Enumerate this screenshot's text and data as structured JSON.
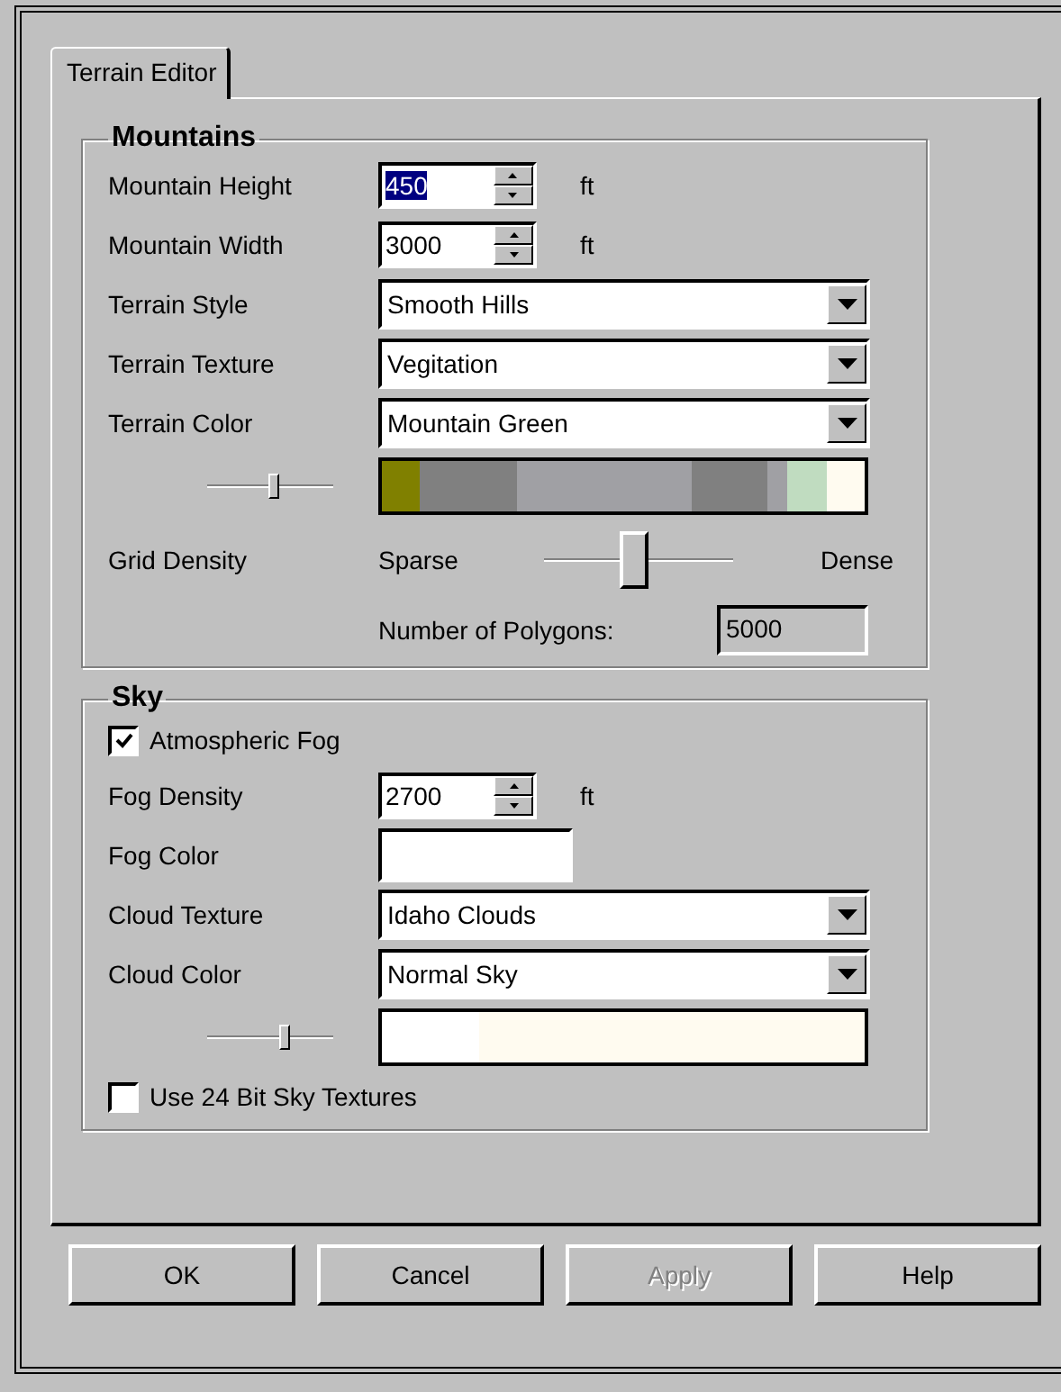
{
  "tab": {
    "label": "Terrain Editor",
    "selected": true
  },
  "groups": [
    {
      "title": "Mountains",
      "rows": [
        {
          "kind": "spinner",
          "label": "Mountain Height",
          "value": "450",
          "value_selected": true,
          "unit": "ft"
        },
        {
          "kind": "spinner",
          "label": "Mountain Width",
          "value": "3000",
          "value_selected": false,
          "unit": "ft"
        },
        {
          "kind": "dropdown",
          "label": "Terrain Style",
          "value": "Smooth Hills"
        },
        {
          "kind": "dropdown",
          "label": "Terrain Texture",
          "value": "Vegitation"
        },
        {
          "kind": "dropdown",
          "label": "Terrain Color",
          "value": "Mountain Green"
        },
        {
          "kind": "strip",
          "level": 0.53,
          "swatches": [
            {
              "color": "#808000"
            },
            {
              "color": "#808000"
            },
            {
              "color": "#808080"
            },
            {
              "color": "#808080"
            },
            {
              "color": "#808080"
            },
            {
              "color": "#808080"
            },
            {
              "color": "#808080"
            },
            {
              "color": "#a0a0a4"
            },
            {
              "color": "#a0a0a4"
            },
            {
              "color": "#a0a0a4"
            },
            {
              "color": "#a0a0a4"
            },
            {
              "color": "#a0a0a4"
            },
            {
              "color": "#a0a0a4"
            },
            {
              "color": "#a0a0a4"
            },
            {
              "color": "#a0a0a4"
            },
            {
              "color": "#a0a0a4"
            },
            {
              "color": "#808080"
            },
            {
              "color": "#808080"
            },
            {
              "color": "#808080"
            },
            {
              "color": "#808080"
            },
            {
              "color": "#a0a0a4"
            },
            {
              "color": "#c0dcc0"
            },
            {
              "color": "#c0dcc0"
            },
            {
              "color": "#fffbf0"
            },
            {
              "color": "#fffbf0"
            }
          ]
        },
        {
          "kind": "range",
          "label": "Grid Density",
          "min_label": "Sparse",
          "max_label": "Dense",
          "level": 0.48
        },
        {
          "kind": "readout",
          "label": "Number of Polygons:",
          "value": "5000"
        }
      ]
    },
    {
      "title": "Sky",
      "rows": [
        {
          "kind": "checkbox",
          "label": "Atmospheric Fog",
          "checked": true
        },
        {
          "kind": "spinner",
          "label": "Fog Density",
          "value": "2700",
          "value_selected": false,
          "unit": "ft"
        },
        {
          "kind": "color",
          "label": "Fog Color",
          "color": "#ffffff"
        },
        {
          "kind": "dropdown",
          "label": "Cloud Texture",
          "value": "Idaho Clouds"
        },
        {
          "kind": "dropdown",
          "label": "Cloud Color",
          "value": "Normal Sky"
        },
        {
          "kind": "strip",
          "level": 0.62,
          "swatches": [
            {
              "color": "#ffffff"
            },
            {
              "color": "#fffbf0"
            },
            {
              "color": "#fffbf0"
            },
            {
              "color": "#fffbf0"
            },
            {
              "color": "#fffbf0"
            }
          ]
        },
        {
          "kind": "checkbox",
          "label": "Use 24 Bit Sky Textures",
          "checked": false
        }
      ]
    }
  ],
  "buttons": [
    {
      "label": "OK",
      "disabled": false
    },
    {
      "label": "Cancel",
      "disabled": false
    },
    {
      "label": "Apply",
      "disabled": true
    },
    {
      "label": "Help",
      "disabled": false
    }
  ]
}
